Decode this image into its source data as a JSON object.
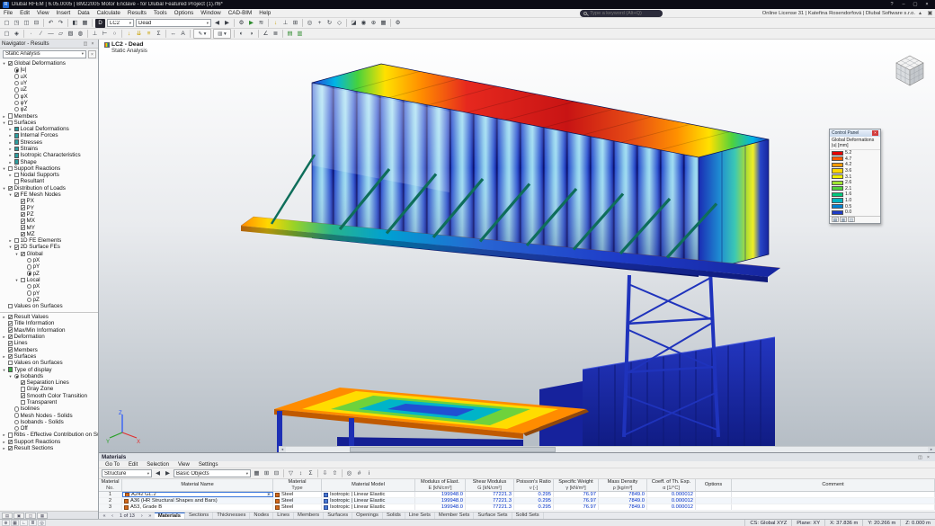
{
  "theme": {
    "accent": "#1e66d0",
    "numeric_text": "#0030c8",
    "titlebar_bg": "#0c0c15",
    "select_green": "#3fae4a"
  },
  "window": {
    "app_icon": "R",
    "title": "Dlubal RFEM | 6.05.0005 | BM22005 Motor Enclave - for Dlubal Featured Project (1).rf6*",
    "help": "?",
    "minimize": "–",
    "maximize": "▢",
    "close": "×"
  },
  "menubar": {
    "items": [
      "File",
      "Edit",
      "View",
      "Insert",
      "Data",
      "Calculate",
      "Results",
      "Tools",
      "Options",
      "Window",
      "CAD-BIM",
      "Help"
    ],
    "search_placeholder": "Type a keyword (Alt+Q)",
    "license_text": "Online License 31 | Kateřina Rosendorfová | Dlubal Software s.r.o."
  },
  "toolbar1": {
    "left_icons": [
      {
        "n": "new-file-icon",
        "g": "▢"
      },
      {
        "n": "open-file-icon",
        "g": "◳"
      },
      {
        "n": "save-icon",
        "g": "◫"
      },
      {
        "n": "print-icon",
        "g": "⊟"
      },
      {
        "n": "separator",
        "c": "sep"
      },
      {
        "n": "undo-icon",
        "g": "↶"
      },
      {
        "n": "redo-icon",
        "g": "↷"
      },
      {
        "n": "separator",
        "c": "sep"
      },
      {
        "n": "navigator-toggle-icon",
        "g": "◧"
      },
      {
        "n": "tables-toggle-icon",
        "g": "▦"
      },
      {
        "n": "separator",
        "c": "sep"
      }
    ],
    "display_button": "D",
    "load_case_combo": "LC2",
    "result_combo": "Dead",
    "right_icons": [
      {
        "n": "prev-load-case-icon",
        "g": "◀"
      },
      {
        "n": "next-load-case-icon",
        "g": "▶"
      },
      {
        "n": "separator",
        "c": "sep"
      },
      {
        "n": "calculate-all-icon",
        "g": "⚙"
      },
      {
        "n": "run-analysis-icon",
        "g": "▶",
        "c": "gre"
      },
      {
        "n": "show-results-icon",
        "g": "≋"
      },
      {
        "n": "separator",
        "c": "sep"
      },
      {
        "n": "loads-icon",
        "g": "↓",
        "c": "yel"
      },
      {
        "n": "supports-icon",
        "g": "⊥"
      },
      {
        "n": "fe-mesh-icon",
        "g": "⊞"
      },
      {
        "n": "separator",
        "c": "sep"
      },
      {
        "n": "zoom-icon",
        "g": "◎"
      },
      {
        "n": "pan-icon",
        "g": "+"
      },
      {
        "n": "rotate-view-icon",
        "g": "↻"
      },
      {
        "n": "isometric-view-icon",
        "g": "◇"
      },
      {
        "n": "separator",
        "c": "sep"
      },
      {
        "n": "clipping-planes-icon",
        "g": "◪"
      },
      {
        "n": "visibility-icon",
        "g": "◉"
      },
      {
        "n": "snap-icon",
        "g": "⊕"
      },
      {
        "n": "grid-icon",
        "g": "▦"
      },
      {
        "n": "separator",
        "c": "sep"
      },
      {
        "n": "settings-icon",
        "g": "⚙"
      }
    ]
  },
  "toolbar2": {
    "icons": [
      {
        "n": "select-objects-icon",
        "g": "▢"
      },
      {
        "n": "select-special-icon",
        "g": "◈"
      },
      {
        "n": "separator",
        "c": "sep"
      },
      {
        "n": "node-icon",
        "g": "∙"
      },
      {
        "n": "line-icon",
        "g": "∕"
      },
      {
        "n": "member-icon",
        "g": "—"
      },
      {
        "n": "surface-icon",
        "g": "▱"
      },
      {
        "n": "solid-icon",
        "g": "▧"
      },
      {
        "n": "opening-icon",
        "g": "◍"
      },
      {
        "n": "separator",
        "c": "sep"
      },
      {
        "n": "nodal-support-icon",
        "g": "⊥"
      },
      {
        "n": "line-support-icon",
        "g": "⊢"
      },
      {
        "n": "member-hinge-icon",
        "g": "○"
      },
      {
        "n": "separator",
        "c": "sep"
      },
      {
        "n": "nodal-load-icon",
        "g": "↓",
        "c": "yel"
      },
      {
        "n": "line-load-icon",
        "g": "⇊",
        "c": "yel"
      },
      {
        "n": "surface-load-icon",
        "g": "≡",
        "c": "yel"
      },
      {
        "n": "load-combinations-icon",
        "g": "Σ"
      },
      {
        "n": "separator",
        "c": "sep"
      },
      {
        "n": "dimensions-icon",
        "g": "↔"
      },
      {
        "n": "text-annotation-icon",
        "g": "A"
      },
      {
        "n": "separator",
        "c": "sep"
      },
      {
        "n": "edit-style-combo",
        "g": "✎ ▾",
        "c": "wide"
      },
      {
        "n": "color-scale-combo",
        "g": "▥ ▾",
        "c": "wide"
      },
      {
        "n": "separator",
        "c": "sep"
      },
      {
        "n": "render-mode-icon",
        "g": "◐"
      },
      {
        "n": "transparency-icon",
        "g": "◑"
      },
      {
        "n": "separator",
        "c": "sep"
      },
      {
        "n": "measure-icon",
        "g": "∠"
      },
      {
        "n": "guide-lines-icon",
        "g": "≣"
      },
      {
        "n": "separator",
        "c": "sep"
      },
      {
        "n": "result-table-toggle-icon",
        "g": "▤",
        "c": "gre"
      },
      {
        "n": "result-diagram-toggle-icon",
        "g": "▥",
        "c": "gre"
      }
    ]
  },
  "navigator": {
    "header": "Navigator - Results",
    "analysis_combo": "Static Analysis",
    "tree": [
      {
        "dc": "d0",
        "eg": "▾",
        "cc": "cb on",
        "t": "Global Deformations"
      },
      {
        "dc": "d1",
        "eg": "",
        "cc": "rb on",
        "t": "|u|"
      },
      {
        "dc": "d1",
        "eg": "",
        "cc": "rb",
        "t": "uX"
      },
      {
        "dc": "d1",
        "eg": "",
        "cc": "rb",
        "t": "uY"
      },
      {
        "dc": "d1",
        "eg": "",
        "cc": "rb",
        "t": "uZ"
      },
      {
        "dc": "d1",
        "eg": "",
        "cc": "rb",
        "t": "φX"
      },
      {
        "dc": "d1",
        "eg": "",
        "cc": "rb",
        "t": "φY"
      },
      {
        "dc": "d1",
        "eg": "",
        "cc": "rb",
        "t": "φZ"
      },
      {
        "dc": "d0",
        "eg": "▸",
        "cc": "cb",
        "t": "Members"
      },
      {
        "dc": "d0",
        "eg": "▾",
        "cc": "cb",
        "t": "Surfaces"
      },
      {
        "dc": "d1",
        "eg": "▸",
        "cc": "sq teal",
        "t": "Local Deformations"
      },
      {
        "dc": "d1",
        "eg": "▸",
        "cc": "sq teal",
        "t": "Internal Forces"
      },
      {
        "dc": "d1",
        "eg": "▸",
        "cc": "sq teal",
        "t": "Stresses"
      },
      {
        "dc": "d1",
        "eg": "▸",
        "cc": "sq teal",
        "t": "Strains"
      },
      {
        "dc": "d1",
        "eg": "▸",
        "cc": "sq teal",
        "t": "Isotropic Characteristics"
      },
      {
        "dc": "d1",
        "eg": "▸",
        "cc": "sq teal",
        "t": "Shape"
      },
      {
        "dc": "d0",
        "eg": "▾",
        "cc": "cb",
        "t": "Support Reactions"
      },
      {
        "dc": "d1",
        "eg": "▸",
        "cc": "cb",
        "t": "Nodal Supports"
      },
      {
        "dc": "d1",
        "eg": "",
        "cc": "cb",
        "t": "Resultant"
      },
      {
        "dc": "d0",
        "eg": "▾",
        "cc": "cb on",
        "t": "Distribution of Loads"
      },
      {
        "dc": "d1",
        "eg": "▾",
        "cc": "cb on",
        "t": "FE Mesh Nodes"
      },
      {
        "dc": "d2",
        "eg": "",
        "cc": "cb on",
        "t": "PX"
      },
      {
        "dc": "d2",
        "eg": "",
        "cc": "cb on",
        "t": "PY"
      },
      {
        "dc": "d2",
        "eg": "",
        "cc": "cb on",
        "t": "PZ"
      },
      {
        "dc": "d2",
        "eg": "",
        "cc": "cb on",
        "t": "MX"
      },
      {
        "dc": "d2",
        "eg": "",
        "cc": "cb on",
        "t": "MY"
      },
      {
        "dc": "d2",
        "eg": "",
        "cc": "cb on",
        "t": "MZ"
      },
      {
        "dc": "d1",
        "eg": "▸",
        "cc": "cb",
        "t": "1D FE Elements"
      },
      {
        "dc": "d1",
        "eg": "▾",
        "cc": "cb on",
        "t": "2D Surface FEs"
      },
      {
        "dc": "d2",
        "eg": "▾",
        "cc": "cb on",
        "t": "Global"
      },
      {
        "dc": "d3",
        "eg": "",
        "cc": "rb",
        "t": "pX"
      },
      {
        "dc": "d3",
        "eg": "",
        "cc": "rb",
        "t": "pY"
      },
      {
        "dc": "d3",
        "eg": "",
        "cc": "rb on",
        "t": "pZ"
      },
      {
        "dc": "d2",
        "eg": "▾",
        "cc": "cb",
        "t": "Local"
      },
      {
        "dc": "d3",
        "eg": "",
        "cc": "rb",
        "t": "pX"
      },
      {
        "dc": "d3",
        "eg": "",
        "cc": "rb",
        "t": "pY"
      },
      {
        "dc": "d3",
        "eg": "",
        "cc": "rb",
        "t": "pZ"
      },
      {
        "dc": "d0",
        "eg": "",
        "cc": "cb",
        "t": "Values on Surfaces"
      }
    ],
    "tree2": [
      {
        "dc": "d0",
        "eg": "▸",
        "cc": "cb on",
        "t": "Result Values"
      },
      {
        "dc": "d0",
        "eg": "",
        "cc": "cb on",
        "t": "Title Information"
      },
      {
        "dc": "d0",
        "eg": "",
        "cc": "cb on",
        "t": "Max/Min Information"
      },
      {
        "dc": "d0",
        "eg": "▸",
        "cc": "cb on",
        "t": "Deformation"
      },
      {
        "dc": "d0",
        "eg": "",
        "cc": "cb on",
        "t": "Lines"
      },
      {
        "dc": "d0",
        "eg": "",
        "cc": "cb on",
        "t": "Members"
      },
      {
        "dc": "d0",
        "eg": "▸",
        "cc": "cb on",
        "t": "Surfaces"
      },
      {
        "dc": "d0",
        "eg": "",
        "cc": "cb",
        "t": "Values on Surfaces"
      },
      {
        "dc": "d0",
        "eg": "▾",
        "cc": "sq green",
        "t": "Type of display"
      },
      {
        "dc": "d1",
        "eg": "▾",
        "cc": "rb on",
        "t": "Isobands"
      },
      {
        "dc": "d2",
        "eg": "",
        "cc": "cb on",
        "t": "Separation Lines"
      },
      {
        "dc": "d2",
        "eg": "",
        "cc": "cb",
        "t": "Gray Zone"
      },
      {
        "dc": "d2",
        "eg": "",
        "cc": "cb on",
        "t": "Smooth Color Transition"
      },
      {
        "dc": "d2",
        "eg": "",
        "cc": "cb",
        "t": "Transparent"
      },
      {
        "dc": "d1",
        "eg": "",
        "cc": "rb",
        "t": "Isolines"
      },
      {
        "dc": "d1",
        "eg": "",
        "cc": "rb",
        "t": "Mesh Nodes - Solids"
      },
      {
        "dc": "d1",
        "eg": "",
        "cc": "rb",
        "t": "Isobands - Solids"
      },
      {
        "dc": "d1",
        "eg": "",
        "cc": "rb",
        "t": "Off"
      },
      {
        "dc": "d0",
        "eg": "▸",
        "cc": "cb",
        "t": "Ribs - Effective Contribution on Surfa..."
      },
      {
        "dc": "d0",
        "eg": "▸",
        "cc": "cb on",
        "t": "Support Reactions"
      },
      {
        "dc": "d0",
        "eg": "▸",
        "cc": "cb on",
        "t": "Result Sections"
      }
    ],
    "tabs": [
      {
        "n": "navigator-tab-data",
        "g": "▤"
      },
      {
        "n": "navigator-tab-display",
        "g": "▣"
      },
      {
        "n": "navigator-tab-views",
        "g": "◫"
      },
      {
        "n": "navigator-tab-results",
        "g": "▦"
      }
    ]
  },
  "viewport": {
    "load_case_label": "LC2 - Dead",
    "analysis_label": "Static Analysis"
  },
  "legend": {
    "title": "Control Panel",
    "close": "×",
    "caption1": "Global Deformations",
    "caption2": "|u| [mm]",
    "entries": [
      {
        "c": "#e60000",
        "v": "5.2"
      },
      {
        "c": "#ff5a00",
        "v": "4.7"
      },
      {
        "c": "#ff9b00",
        "v": "4.2"
      },
      {
        "c": "#ffd700",
        "v": "3.6"
      },
      {
        "c": "#f0f000",
        "v": "3.1"
      },
      {
        "c": "#a0e632",
        "v": "2.6"
      },
      {
        "c": "#50d23c",
        "v": "2.1"
      },
      {
        "c": "#00c87d",
        "v": "1.6"
      },
      {
        "c": "#00b4be",
        "v": "1.0"
      },
      {
        "c": "#0082d2",
        "v": "0.5"
      },
      {
        "c": "#1e3cc8",
        "v": "0.0"
      }
    ],
    "footer_icons": [
      "▤",
      "▥",
      "◫"
    ]
  },
  "materials_panel": {
    "title": "Materials",
    "menus": [
      "Go To",
      "Edit",
      "Selection",
      "View",
      "Settings"
    ],
    "structure_combo": "Structure",
    "filter_combo": "Basic Objects",
    "toolbar_icons": [
      {
        "n": "table-settings-icon",
        "g": "▦"
      },
      {
        "n": "add-row-icon",
        "g": "⊞"
      },
      {
        "n": "delete-row-icon",
        "g": "⊟"
      },
      {
        "n": "separator",
        "c": "sep"
      },
      {
        "n": "filter-icon",
        "g": "▽"
      },
      {
        "n": "sort-icon",
        "g": "↕"
      },
      {
        "n": "sum-icon",
        "g": "Σ"
      },
      {
        "n": "separator",
        "c": "sep"
      },
      {
        "n": "import-icon",
        "g": "⇩"
      },
      {
        "n": "export-icon",
        "g": "⇧"
      },
      {
        "n": "separator",
        "c": "sep"
      },
      {
        "n": "search-icon",
        "g": "◎"
      },
      {
        "n": "calculator-icon",
        "g": "#"
      },
      {
        "n": "info-icon",
        "g": "i"
      }
    ],
    "columns": [
      {
        "l": "Material",
        "u": "No."
      },
      {
        "l": "Material Name",
        "u": ""
      },
      {
        "l": "Material",
        "u": "Type"
      },
      {
        "l": "Material Model",
        "u": ""
      },
      {
        "l": "Modulus of Elast.",
        "u": "E [kN/cm²]"
      },
      {
        "l": "Shear Modulus",
        "u": "G [kN/cm²]"
      },
      {
        "l": "Poisson's Ratio",
        "u": "ν [-]"
      },
      {
        "l": "Specific Weight",
        "u": "γ [kN/m³]"
      },
      {
        "l": "Mass Density",
        "u": "ρ [kg/m³]"
      },
      {
        "l": "Coeff. of Th. Exp.",
        "u": "α [1/°C]"
      },
      {
        "l": "Options",
        "u": ""
      },
      {
        "l": "Comment",
        "u": ""
      }
    ],
    "rows": [
      {
        "no": "1",
        "name": "A242 GL.2",
        "type": "Steel",
        "model": "Isotropic | Linear Elastic",
        "E": "199948.0",
        "G": "77221.3",
        "nu": "0.295",
        "gw": "76.97",
        "rho": "7849.0",
        "alpha": "0.000012",
        "rc": "editing"
      },
      {
        "no": "2",
        "name": "A36 (HR Structural Shapes and Bars)",
        "type": "Steel",
        "model": "Isotropic | Linear Elastic",
        "E": "199948.0",
        "G": "77221.3",
        "nu": "0.295",
        "gw": "76.97",
        "rho": "7849.0",
        "alpha": "0.000012",
        "rc": "alt"
      },
      {
        "no": "3",
        "name": "A53, Grade B",
        "type": "Steel",
        "model": "Isotropic | Linear Elastic",
        "E": "199948.0",
        "G": "77221.3",
        "nu": "0.295",
        "gw": "76.97",
        "rho": "7849.0",
        "alpha": "0.000012",
        "rc": "plain"
      }
    ],
    "nav": {
      "first": "«",
      "prev": "‹",
      "label": "1 of 13",
      "next": "›",
      "last": "»"
    },
    "tabs": [
      {
        "t": "Materials",
        "c": "active"
      },
      {
        "t": "Sections"
      },
      {
        "t": "Thicknesses"
      },
      {
        "t": "Nodes"
      },
      {
        "t": "Lines"
      },
      {
        "t": "Members"
      },
      {
        "t": "Surfaces"
      },
      {
        "t": "Openings"
      },
      {
        "t": "Solids"
      },
      {
        "t": "Line Sets"
      },
      {
        "t": "Member Sets"
      },
      {
        "t": "Surface Sets"
      },
      {
        "t": "Solid Sets"
      }
    ]
  },
  "statusbar": {
    "icons": [
      {
        "n": "snap-toggle-icon",
        "g": "⊕"
      },
      {
        "n": "grid-toggle-icon",
        "g": "▦"
      },
      {
        "n": "ortho-toggle-icon",
        "g": "∟"
      },
      {
        "n": "guidelines-toggle-icon",
        "g": "≣"
      },
      {
        "n": "object-snap-toggle-icon",
        "g": "◎"
      }
    ],
    "cs": "CS: Global XYZ",
    "plane": "Plane: XY",
    "x": "X: 37.836 m",
    "y": "Y: 20.266 m",
    "z": "Z: 0.000 m"
  }
}
